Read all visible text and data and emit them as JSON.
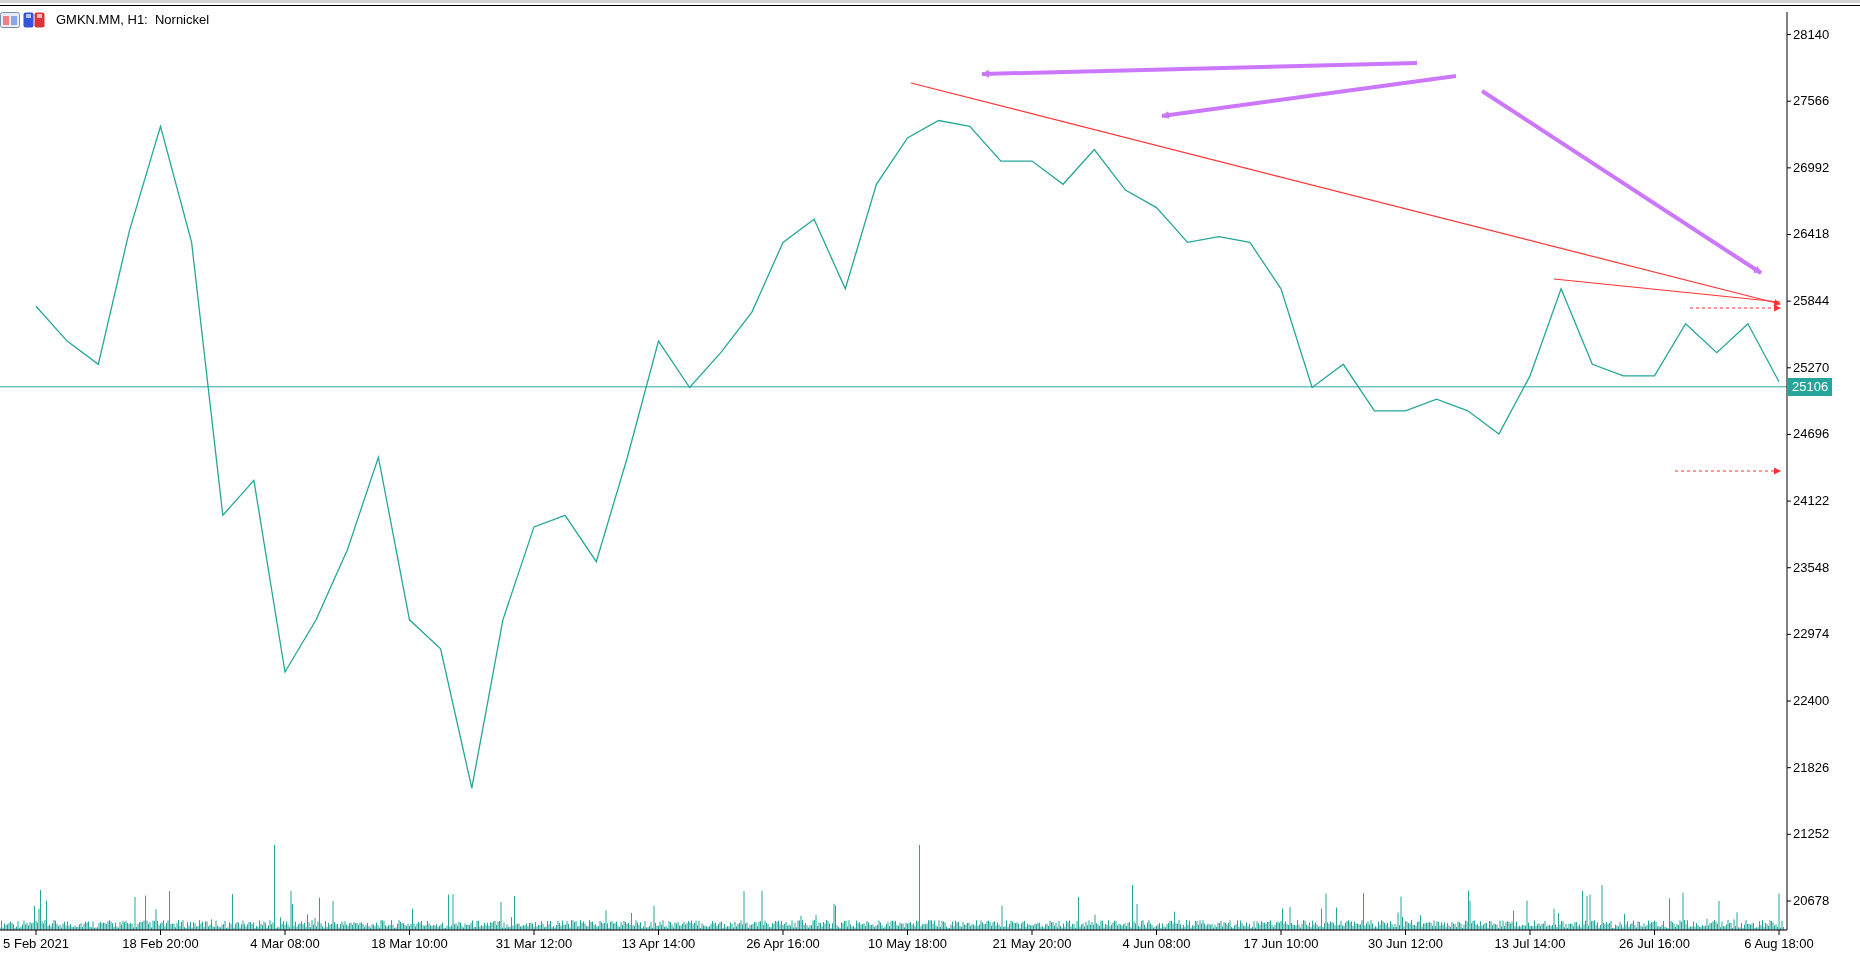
{
  "chart_header": {
    "title": "GMKN.MM, H1:  Nornickel"
  },
  "chart": {
    "current_price": "25106",
    "chart_data": {
      "type": "line",
      "ylim": [
        20428,
        28317
      ],
      "categories": [
        "5 Feb 2021",
        null,
        null,
        null,
        "18 Feb 20:00",
        null,
        null,
        null,
        "4 Mar 08:00",
        null,
        null,
        null,
        "18 Mar 10:00",
        null,
        null,
        null,
        "31 Mar 12:00",
        null,
        null,
        null,
        "13 Apr 14:00",
        null,
        null,
        null,
        "26 Apr 16:00",
        null,
        null,
        null,
        "10 May 18:00",
        null,
        null,
        null,
        "21 May 20:00",
        null,
        null,
        null,
        "4 Jun 08:00",
        null,
        null,
        null,
        "17 Jun 10:00",
        null,
        null,
        null,
        "30 Jun 12:00",
        null,
        null,
        null,
        "13 Jul 14:00",
        null,
        null,
        null,
        "26 Jul 16:00",
        null,
        null,
        null,
        "6 Aug 18:00"
      ],
      "series": [
        {
          "color": "#26a69a",
          "values": [
            25800,
            25500,
            25300,
            26450,
            27350,
            26350,
            24000,
            24300,
            22650,
            23100,
            23700,
            24500,
            23100,
            22850,
            21650,
            23100,
            23900,
            24000,
            23600,
            24500,
            25500,
            25100,
            25400,
            25750,
            26350,
            26550,
            25950,
            26850,
            27250,
            27400,
            27350,
            27050,
            27050,
            26850,
            27150,
            26800,
            26650,
            26350,
            26400,
            26350,
            25950,
            25100,
            25300,
            24900,
            24900,
            25000,
            24900,
            24700,
            25200,
            25950,
            25300,
            25200,
            25200,
            25650,
            25400,
            25650,
            25150
          ]
        }
      ],
      "ref_lines": [
        {
          "axis": "y",
          "value": 25106,
          "color": "#26a69a"
        }
      ],
      "yticks": [
        28140,
        27566,
        26992,
        26418,
        25844,
        25270,
        24696,
        24122,
        23548,
        22974,
        22400,
        21826,
        21252,
        20678
      ]
    }
  }
}
